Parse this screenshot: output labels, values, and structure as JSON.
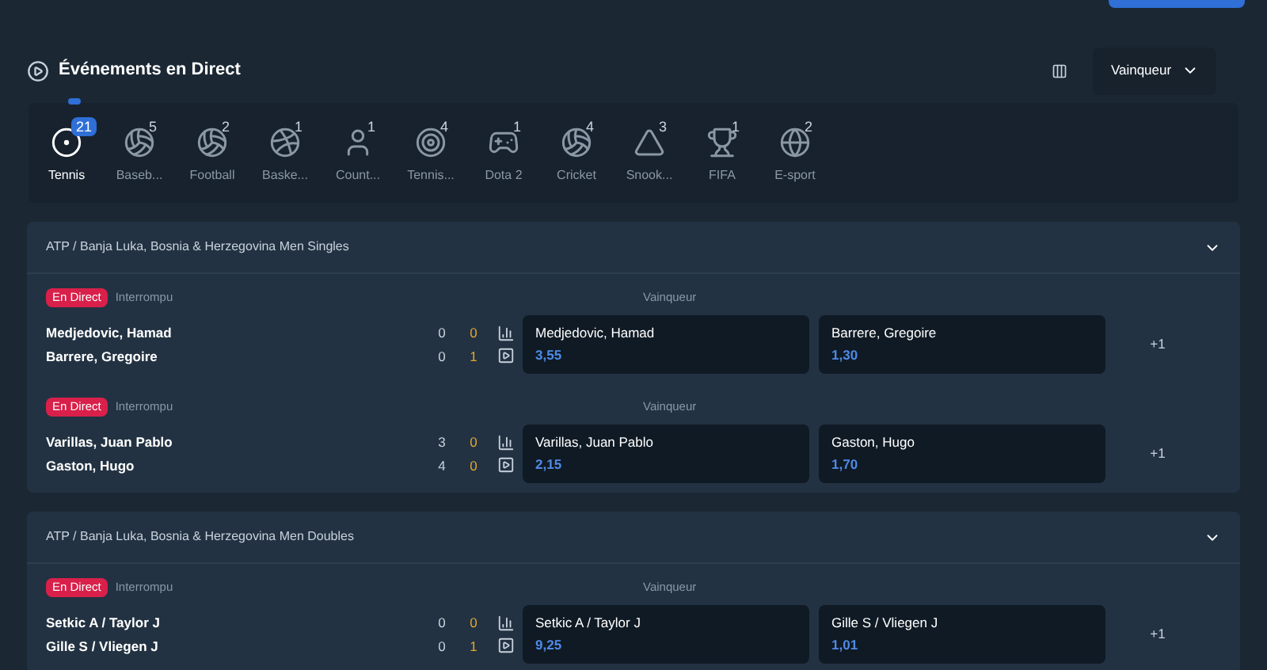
{
  "header": {
    "title": "Événements en Direct",
    "market_select": {
      "value": "Vainqueur"
    }
  },
  "sports": [
    {
      "label": "Tennis",
      "count": "21",
      "selected": true
    },
    {
      "label": "Baseb...",
      "count": "5",
      "selected": false
    },
    {
      "label": "Football",
      "count": "2",
      "selected": false
    },
    {
      "label": "Baske...",
      "count": "1",
      "selected": false
    },
    {
      "label": "Count...",
      "count": "1",
      "selected": false
    },
    {
      "label": "Tennis...",
      "count": "4",
      "selected": false
    },
    {
      "label": "Dota 2",
      "count": "1",
      "selected": false
    },
    {
      "label": "Cricket",
      "count": "4",
      "selected": false
    },
    {
      "label": "Snook...",
      "count": "3",
      "selected": false
    },
    {
      "label": "FIFA",
      "count": "1",
      "selected": false
    },
    {
      "label": "E-sport",
      "count": "2",
      "selected": false
    }
  ],
  "competitions": [
    {
      "title": "ATP / Banja Luka, Bosnia & Herzegovina Men Singles",
      "matches": [
        {
          "live_badge": "En Direct",
          "status": "Interrompu",
          "market": "Vainqueur",
          "more": "+1",
          "players": [
            {
              "name": "Medjedovic, Hamad",
              "sets": "0",
              "games": "0",
              "odds_label": "Medjedovic, Hamad",
              "odds": "3,55"
            },
            {
              "name": "Barrere, Gregoire",
              "sets": "0",
              "games": "1",
              "odds_label": "Barrere, Gregoire",
              "odds": "1,30"
            }
          ]
        },
        {
          "live_badge": "En Direct",
          "status": "Interrompu",
          "market": "Vainqueur",
          "more": "+1",
          "players": [
            {
              "name": "Varillas, Juan Pablo",
              "sets": "3",
              "games": "0",
              "odds_label": "Varillas, Juan Pablo",
              "odds": "2,15"
            },
            {
              "name": "Gaston, Hugo",
              "sets": "4",
              "games": "0",
              "odds_label": "Gaston, Hugo",
              "odds": "1,70"
            }
          ]
        }
      ]
    },
    {
      "title": "ATP / Banja Luka, Bosnia & Herzegovina Men Doubles",
      "matches": [
        {
          "live_badge": "En Direct",
          "status": "Interrompu",
          "market": "Vainqueur",
          "more": "+1",
          "players": [
            {
              "name": "Setkic A / Taylor J",
              "sets": "0",
              "games": "0",
              "odds_label": "Setkic A / Taylor J",
              "odds": "9,25"
            },
            {
              "name": "Gille S / Vliegen J",
              "sets": "0",
              "games": "1",
              "odds_label": "Gille S / Vliegen J",
              "odds": "1,01"
            }
          ]
        }
      ]
    }
  ]
}
